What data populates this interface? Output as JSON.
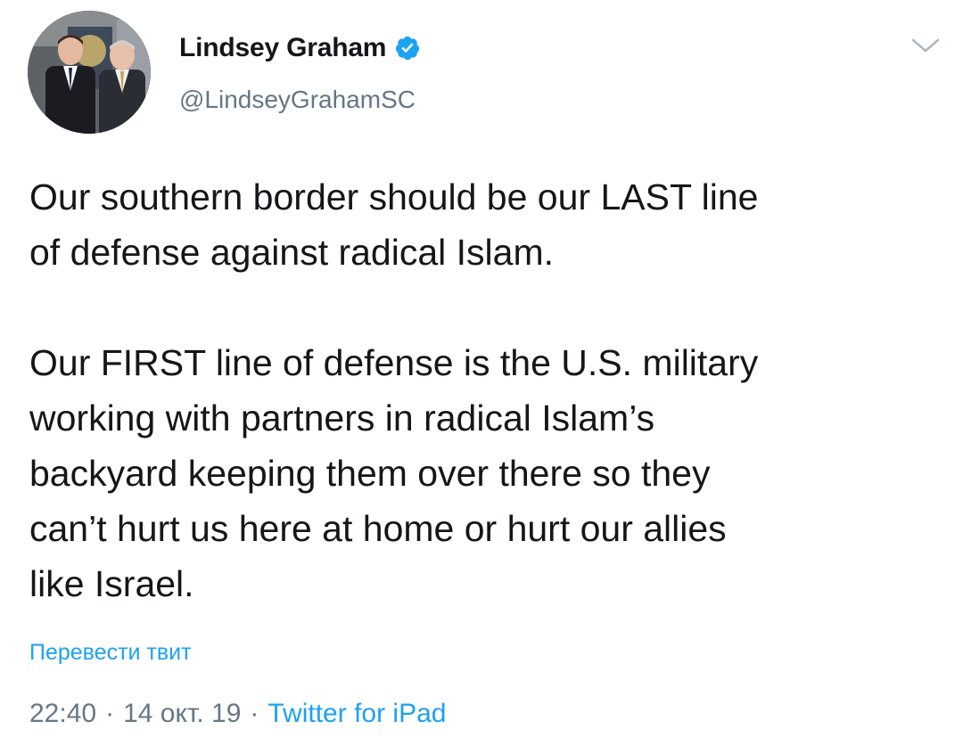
{
  "author": {
    "display_name": "Lindsey Graham",
    "handle": "@LindseyGrahamSC",
    "verified": true,
    "avatar_icon": "profile-photo"
  },
  "menu": {
    "icon": "chevron-down-icon"
  },
  "tweet": {
    "text": "Our southern border should be our LAST line\nof defense against radical Islam.\n\nOur FIRST line of defense is the U.S. military\nworking with partners in radical Islam’s\nbackyard keeping them over there so they\ncan’t hurt us here at home or hurt our allies\nlike Israel.",
    "translate_label": "Перевести твит"
  },
  "meta": {
    "time": "22:40",
    "separator": "·",
    "date": "14 окт. 19",
    "source": "Twitter for iPad"
  },
  "colors": {
    "link": "#1da1f2",
    "secondary_text": "#657786",
    "primary_text": "#14171a",
    "verified_badge": "#1da1f2"
  }
}
